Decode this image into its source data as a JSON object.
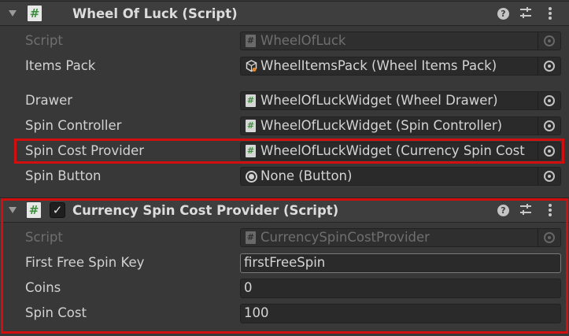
{
  "component1": {
    "title": "Wheel Of Luck (Script)",
    "script_label": "Script",
    "script_value": "WheelOfLuck",
    "items_pack_label": "Items Pack",
    "items_pack_value": "WheelItemsPack (Wheel Items Pack)",
    "drawer_label": "Drawer",
    "drawer_value": "WheelOfLuckWidget (Wheel Drawer)",
    "spin_controller_label": "Spin Controller",
    "spin_controller_value": "WheelOfLuckWidget (Spin Controller)",
    "spin_cost_provider_label": "Spin Cost Provider",
    "spin_cost_provider_value": "WheelOfLuckWidget (Currency Spin Cost",
    "spin_button_label": "Spin Button",
    "spin_button_value": "None (Button)"
  },
  "component2": {
    "title": "Currency Spin Cost Provider (Script)",
    "enabled": true,
    "script_label": "Script",
    "script_value": "CurrencySpinCostProvider",
    "first_free_spin_key_label": "First Free Spin Key",
    "first_free_spin_key_value": "firstFreeSpin",
    "coins_label": "Coins",
    "coins_value": "0",
    "spin_cost_label": "Spin Cost",
    "spin_cost_value": "100"
  },
  "icons": {
    "foldout": "triangle-down",
    "script": "csharp-script",
    "help": "question-circle",
    "presets": "sliders",
    "menu": "vertical-ellipsis",
    "object_picker": "target-circle",
    "scriptable_object": "cube-asset",
    "component_ref": "radio-dot"
  },
  "colors": {
    "highlight": "#d20f0f",
    "background": "#383838",
    "field_background": "#2a2a2a"
  }
}
